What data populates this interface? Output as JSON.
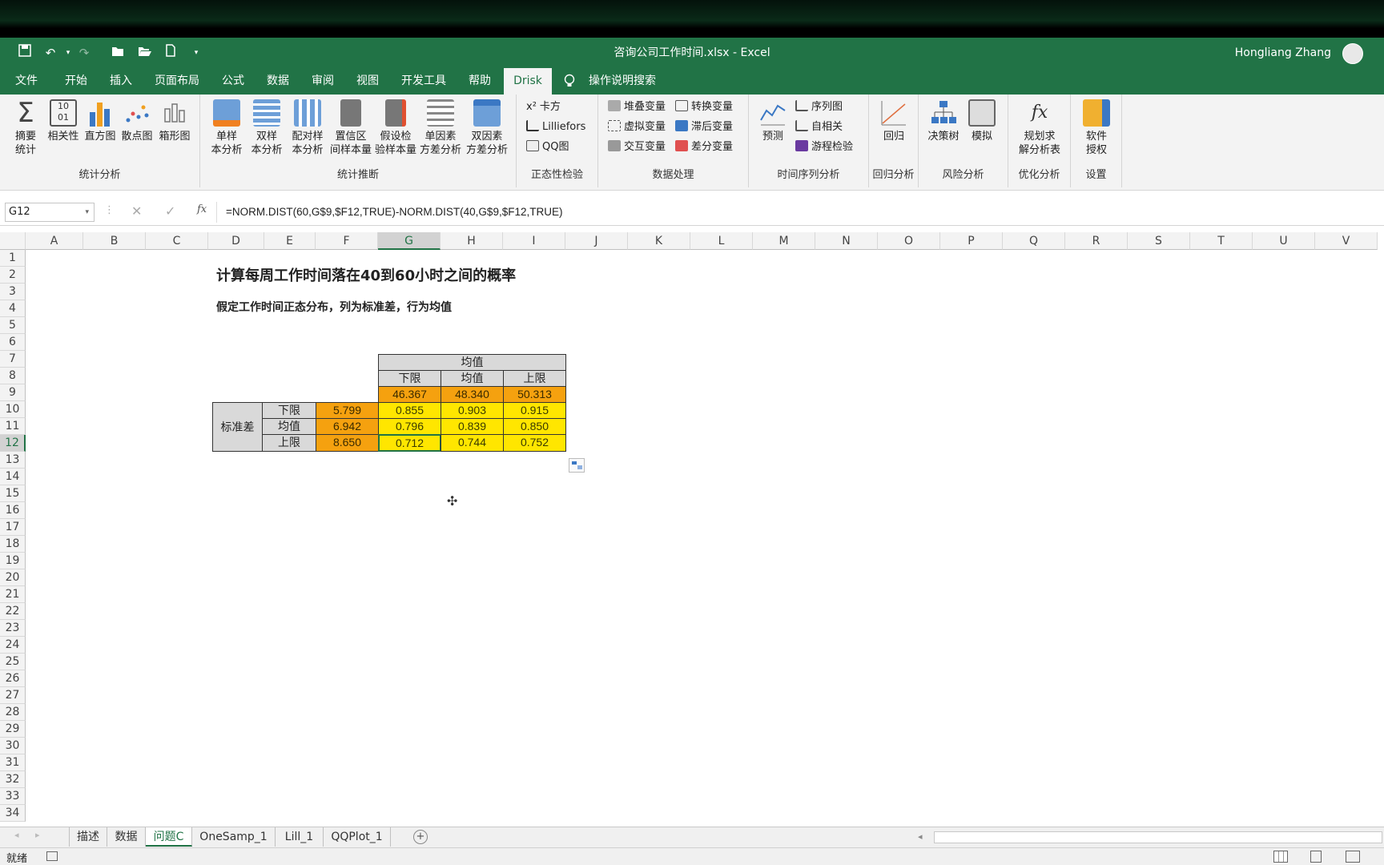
{
  "app": {
    "doc_title": "咨询公司工作时间.xlsx  -  Excel",
    "user": "Hongliang Zhang"
  },
  "ribbon_tabs": [
    "文件",
    "开始",
    "插入",
    "页面布局",
    "公式",
    "数据",
    "审阅",
    "视图",
    "开发工具",
    "帮助",
    "Drisk"
  ],
  "search": {
    "label": "操作说明搜索"
  },
  "groups": {
    "stat": {
      "label": "统计分析",
      "buttons": [
        [
          "摘要",
          "统计"
        ],
        [
          "相关性",
          ""
        ],
        [
          "直方图",
          ""
        ],
        [
          "散点图",
          ""
        ],
        [
          "箱形图",
          ""
        ]
      ]
    },
    "infer": {
      "label": "统计推断",
      "buttons": [
        [
          "单样",
          "本分析"
        ],
        [
          "双样",
          "本分析"
        ],
        [
          "配对样",
          "本分析"
        ],
        [
          "置信区",
          "间样本量"
        ],
        [
          "假设检",
          "验样本量"
        ],
        [
          "单因素",
          "方差分析"
        ],
        [
          "双因素",
          "方差分析"
        ]
      ]
    },
    "norm": {
      "label": "正态性检验",
      "items": [
        "卡方",
        "Lilliefors",
        "QQ图"
      ]
    },
    "data": {
      "label": "数据处理",
      "items": [
        "堆叠变量",
        "虚拟变量",
        "交互变量",
        "转换变量",
        "滞后变量",
        "差分变量"
      ]
    },
    "ts": {
      "label": "时间序列分析",
      "big": "预测",
      "items": [
        "序列图",
        "自相关",
        "游程检验"
      ]
    },
    "reg": {
      "label": "回归分析",
      "big": "回归"
    },
    "risk": {
      "label": "风险分析",
      "buttons": [
        "决策树",
        "模拟"
      ]
    },
    "opt": {
      "label": "优化分析",
      "buttons": [
        [
          "规划求",
          "解分析表"
        ]
      ]
    },
    "set": {
      "label": "设置",
      "buttons": [
        [
          "软件",
          "授权"
        ]
      ]
    }
  },
  "formula_bar": {
    "name_box": "G12",
    "formula": "=NORM.DIST(60,G$9,$F12,TRUE)-NORM.DIST(40,G$9,$F12,TRUE)",
    "fx": "fx"
  },
  "columns": [
    "A",
    "B",
    "C",
    "D",
    "E",
    "F",
    "G",
    "H",
    "I",
    "J",
    "K",
    "L",
    "M",
    "N",
    "O",
    "P",
    "Q",
    "R",
    "S",
    "T",
    "U",
    "V"
  ],
  "sheet": {
    "title": "计算每周工作时间落在40到60小时之间的概率",
    "subtitle": "假定工作时间正态分布，列为标准差，行为均值",
    "mean_header": "均值",
    "col_labels": [
      "下限",
      "均值",
      "上限"
    ],
    "means": [
      "46.367",
      "48.340",
      "50.313"
    ],
    "sd_header": "标准差",
    "row_labels": [
      "下限",
      "均值",
      "上限"
    ],
    "sds": [
      "5.799",
      "6.942",
      "8.650"
    ],
    "probs": [
      [
        "0.855",
        "0.903",
        "0.915"
      ],
      [
        "0.796",
        "0.839",
        "0.850"
      ],
      [
        "0.712",
        "0.744",
        "0.752"
      ]
    ]
  },
  "sheet_tabs": [
    "描述",
    "数据",
    "问题C",
    "OneSamp_1",
    "Lill_1",
    "QQPlot_1"
  ],
  "status": {
    "ready": "就绪"
  }
}
